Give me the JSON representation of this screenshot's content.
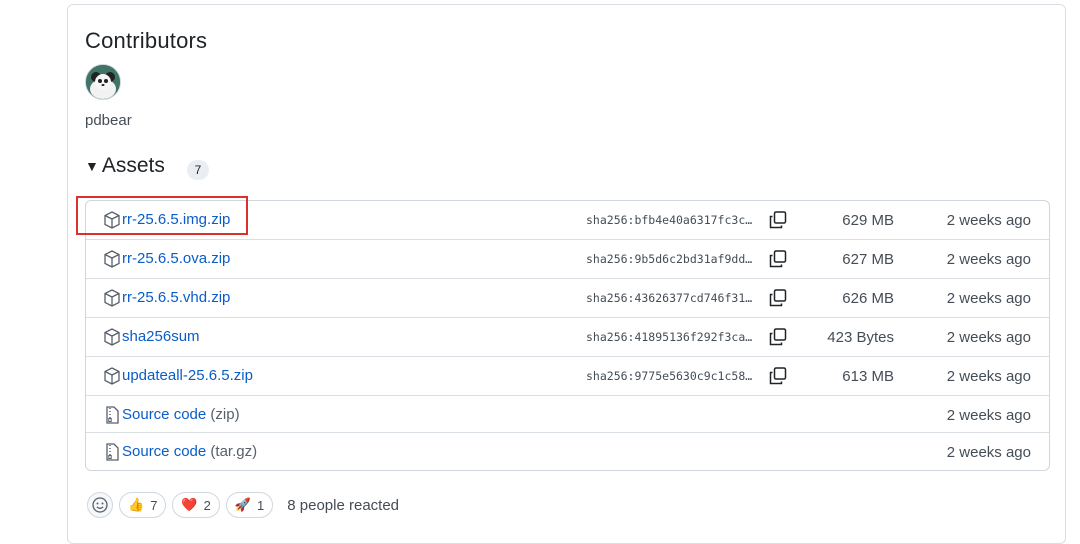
{
  "contributors": {
    "title": "Contributors",
    "users": [
      {
        "name": "pdbear"
      }
    ]
  },
  "assets": {
    "title": "Assets",
    "count": "7",
    "rows": [
      {
        "name": "rr-25.6.5.img.zip",
        "sub": "",
        "icon": "package-icon",
        "sha": "sha256:bfb4e40a6317fc3c…",
        "size": "629 MB",
        "when": "2 weeks ago"
      },
      {
        "name": "rr-25.6.5.ova.zip",
        "sub": "",
        "icon": "package-icon",
        "sha": "sha256:9b5d6c2bd31af9dd…",
        "size": "627 MB",
        "when": "2 weeks ago"
      },
      {
        "name": "rr-25.6.5.vhd.zip",
        "sub": "",
        "icon": "package-icon",
        "sha": "sha256:43626377cd746f31…",
        "size": "626 MB",
        "when": "2 weeks ago"
      },
      {
        "name": "sha256sum",
        "sub": "",
        "icon": "package-icon",
        "sha": "sha256:41895136f292f3ca…",
        "size": "423 Bytes",
        "when": "2 weeks ago"
      },
      {
        "name": "updateall-25.6.5.zip",
        "sub": "",
        "icon": "package-icon",
        "sha": "sha256:9775e5630c9c1c58…",
        "size": "613 MB",
        "when": "2 weeks ago"
      },
      {
        "name": "Source code",
        "sub": "(zip)",
        "icon": "file-zip-icon",
        "sha": "",
        "size": "",
        "when": "2 weeks ago"
      },
      {
        "name": "Source code",
        "sub": "(tar.gz)",
        "icon": "file-zip-icon",
        "sha": "",
        "size": "",
        "when": "2 weeks ago"
      }
    ]
  },
  "reactions": {
    "items": [
      {
        "emoji": "👍",
        "count": "7",
        "name": "thumbs-up"
      },
      {
        "emoji": "❤️",
        "count": "2",
        "name": "heart"
      },
      {
        "emoji": "🚀",
        "count": "1",
        "name": "rocket"
      }
    ],
    "summary": "8 people reacted"
  },
  "colors": {
    "link": "#0a5cc9",
    "highlight": "#d9312b"
  }
}
